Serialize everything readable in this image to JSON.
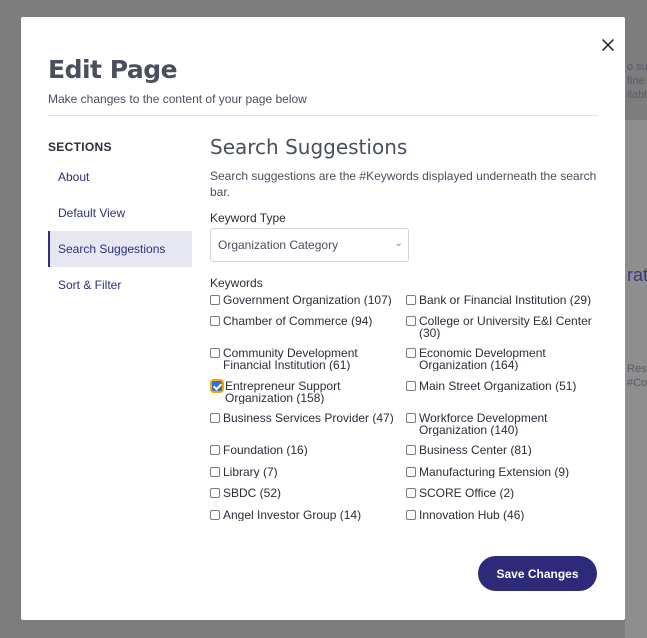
{
  "modal": {
    "title": "Edit Page",
    "subtitle": "Make changes to the content of your page below"
  },
  "sidebar": {
    "heading": "SECTIONS",
    "items": [
      {
        "label": "About"
      },
      {
        "label": "Default View"
      },
      {
        "label": "Search Suggestions",
        "active": true
      },
      {
        "label": "Sort & Filter"
      }
    ]
  },
  "section": {
    "title": "Search Suggestions",
    "description": "Search suggestions are the #Keywords displayed underneath the search bar.",
    "keyword_type_label": "Keyword Type",
    "keyword_type_value": "Organization Category",
    "keywords_label": "Keywords",
    "keywords": [
      {
        "label": "Government Organization (107)",
        "checked": false
      },
      {
        "label": "Bank or Financial Institution (29)",
        "checked": false
      },
      {
        "label": "Chamber of Commerce (94)",
        "checked": false
      },
      {
        "label": "College or University E&I Center (30)",
        "checked": false
      },
      {
        "label": "Community Development Financial Institution (61)",
        "checked": false
      },
      {
        "label": "Economic Development Organization (164)",
        "checked": false
      },
      {
        "label": "Entrepreneur Support Organization (158)",
        "checked": true
      },
      {
        "label": "Main Street Organization (51)",
        "checked": false
      },
      {
        "label": "Business Services Provider (47)",
        "checked": false
      },
      {
        "label": "Workforce Development Organization (140)",
        "checked": false
      },
      {
        "label": "Foundation (16)",
        "checked": false
      },
      {
        "label": "Business Center (81)",
        "checked": false
      },
      {
        "label": "Library (7)",
        "checked": false
      },
      {
        "label": "Manufacturing Extension (9)",
        "checked": false
      },
      {
        "label": "SBDC (52)",
        "checked": false
      },
      {
        "label": "SCORE Office (2)",
        "checked": false
      },
      {
        "label": "Angel Investor Group (14)",
        "checked": false
      },
      {
        "label": "Innovation Hub (46)",
        "checked": false
      }
    ]
  },
  "actions": {
    "save_label": "Save Changes"
  },
  "background": {
    "right_text_1": "o su",
    "right_text_2": "fine",
    "right_text_3": "ilable",
    "right_heading": "ratio",
    "right_text_4": "Reso",
    "right_text_5": "#Co"
  },
  "colors": {
    "accent": "#2d2a7a",
    "text": "#4a4f5e",
    "checkbox_checked": "#2f6fd6",
    "focus_ring": "#f2a900"
  }
}
